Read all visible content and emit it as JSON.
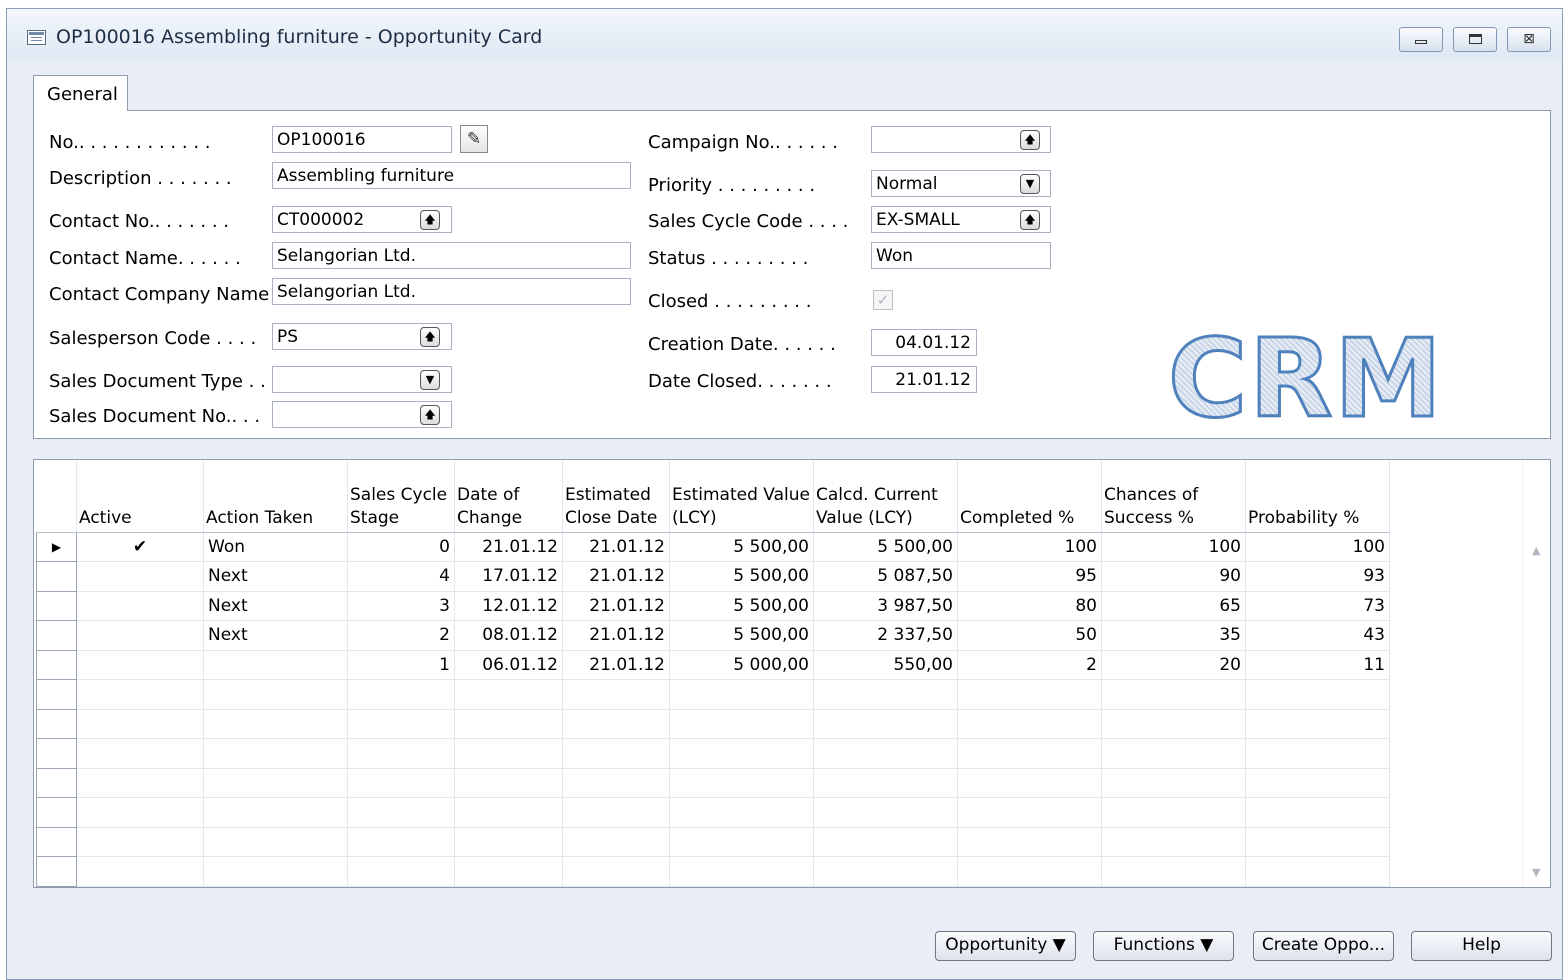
{
  "window": {
    "title": "OP100016 Assembling furniture - Opportunity Card",
    "minimize_icon": "minimize-icon",
    "maximize_icon": "maximize-icon",
    "close_icon": "close-icon",
    "close_glyph": "⊠"
  },
  "tabs": [
    {
      "label": "General",
      "selected": true
    }
  ],
  "general": {
    "no_label": "No.. . . . . . . . . . . .",
    "no_value": "OP100016",
    "description_label": "Description . . . . . . .",
    "description_value": "Assembling furniture",
    "contact_no_label": "Contact No.. . . . . . .",
    "contact_no_value": "CT000002",
    "contact_name_label": "Contact Name. . . . . .",
    "contact_name_value": "Selangorian Ltd.",
    "contact_company_label": "Contact Company Name .",
    "contact_company_value": "Selangorian Ltd.",
    "salesperson_label": "Salesperson Code . . . .",
    "salesperson_value": "PS",
    "sales_doc_type_label": "Sales Document Type . .",
    "sales_doc_type_value": "",
    "sales_doc_no_label": "Sales Document No.. . .",
    "sales_doc_no_value": "",
    "campaign_label": "Campaign No.. . . . . .",
    "campaign_value": "",
    "priority_label": "Priority . . . . . . . . .",
    "priority_value": "Normal",
    "sales_cycle_label": "Sales Cycle Code . . . .",
    "sales_cycle_value": "EX-SMALL",
    "status_label": "Status . . . . . . . . .",
    "status_value": "Won",
    "closed_label": "Closed . . . . . . . . .",
    "closed_checked": true,
    "closed_glyph": "✓",
    "creation_date_label": "Creation Date. . . . . .",
    "creation_date_value": "04.01.12",
    "date_closed_label": "Date Closed. . . . . . .",
    "date_closed_value": "21.01.12",
    "watermark": "CRM",
    "lookup_glyph": "🡅",
    "dropdown_glyph": "▼",
    "edit_glyph": "✎"
  },
  "grid": {
    "columns": [
      "Active",
      "Action Taken",
      "Sales Cycle Stage",
      "Date of Change",
      "Estimated Close Date",
      "Estimated Value (LCY)",
      "Calcd. Current Value (LCY)",
      "Completed %",
      "Chances of Success %",
      "Probability %"
    ],
    "rows": [
      {
        "selected": true,
        "active": "✔",
        "action": "Won",
        "stage": "0",
        "date_change": "21.01.12",
        "close_date": "21.01.12",
        "est_value": "5 500,00",
        "curr_value": "5 500,00",
        "completed": "100",
        "chances": "100",
        "probability": "100"
      },
      {
        "selected": false,
        "active": "",
        "action": "Next",
        "stage": "4",
        "date_change": "17.01.12",
        "close_date": "21.01.12",
        "est_value": "5 500,00",
        "curr_value": "5 087,50",
        "completed": "95",
        "chances": "90",
        "probability": "93"
      },
      {
        "selected": false,
        "active": "",
        "action": "Next",
        "stage": "3",
        "date_change": "12.01.12",
        "close_date": "21.01.12",
        "est_value": "5 500,00",
        "curr_value": "3 987,50",
        "completed": "80",
        "chances": "65",
        "probability": "73"
      },
      {
        "selected": false,
        "active": "",
        "action": "Next",
        "stage": "2",
        "date_change": "08.01.12",
        "close_date": "21.01.12",
        "est_value": "5 500,00",
        "curr_value": "2 337,50",
        "completed": "50",
        "chances": "35",
        "probability": "43"
      },
      {
        "selected": false,
        "active": "",
        "action": "",
        "stage": "1",
        "date_change": "06.01.12",
        "close_date": "21.01.12",
        "est_value": "5 000,00",
        "curr_value": "550,00",
        "completed": "2",
        "chances": "20",
        "probability": "11"
      }
    ],
    "empty_rows": 7,
    "row_pointer_glyph": "▶",
    "scroll_up_glyph": "▲",
    "scroll_down_glyph": "▼"
  },
  "buttons": {
    "opportunity": "Opportunity ▼",
    "functions": "Functions ▼",
    "create": "Create Oppo...",
    "help": "Help"
  }
}
